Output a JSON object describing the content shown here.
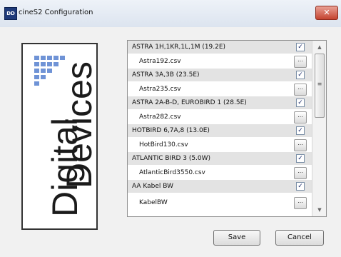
{
  "window": {
    "title": "cineS2 Configuration",
    "close_glyph": "✕"
  },
  "logo": {
    "line1": "Digital",
    "line2": "Devices"
  },
  "channels": [
    {
      "satellite": "ASTRA 1H,1KR,1L,1M (19.2E)",
      "checked": true,
      "file": "Astra192.csv"
    },
    {
      "satellite": "ASTRA 3A,3B (23.5E)",
      "checked": true,
      "file": "Astra235.csv"
    },
    {
      "satellite": "ASTRA 2A-B-D, EUROBIRD 1 (28.5E)",
      "checked": true,
      "file": "Astra282.csv"
    },
    {
      "satellite": "HOTBIRD 6,7A,8 (13.0E)",
      "checked": true,
      "file": "HotBird130.csv"
    },
    {
      "satellite": "ATLANTIC BIRD 3 (5.0W)",
      "checked": true,
      "file": "AtlanticBird3550.csv"
    },
    {
      "satellite": "AA Kabel BW",
      "checked": true,
      "file": "KabelBW"
    }
  ],
  "browse_label": "...",
  "check_glyph": "✓",
  "scrollbar": {
    "up_glyph": "▲",
    "down_glyph": "▼",
    "grip_glyph": "≡"
  },
  "buttons": {
    "save": "Save",
    "cancel": "Cancel"
  },
  "colors": {
    "sat_row": "#e3e3e3",
    "logo_blue": "#3a63b5",
    "close": "#c4432f"
  }
}
